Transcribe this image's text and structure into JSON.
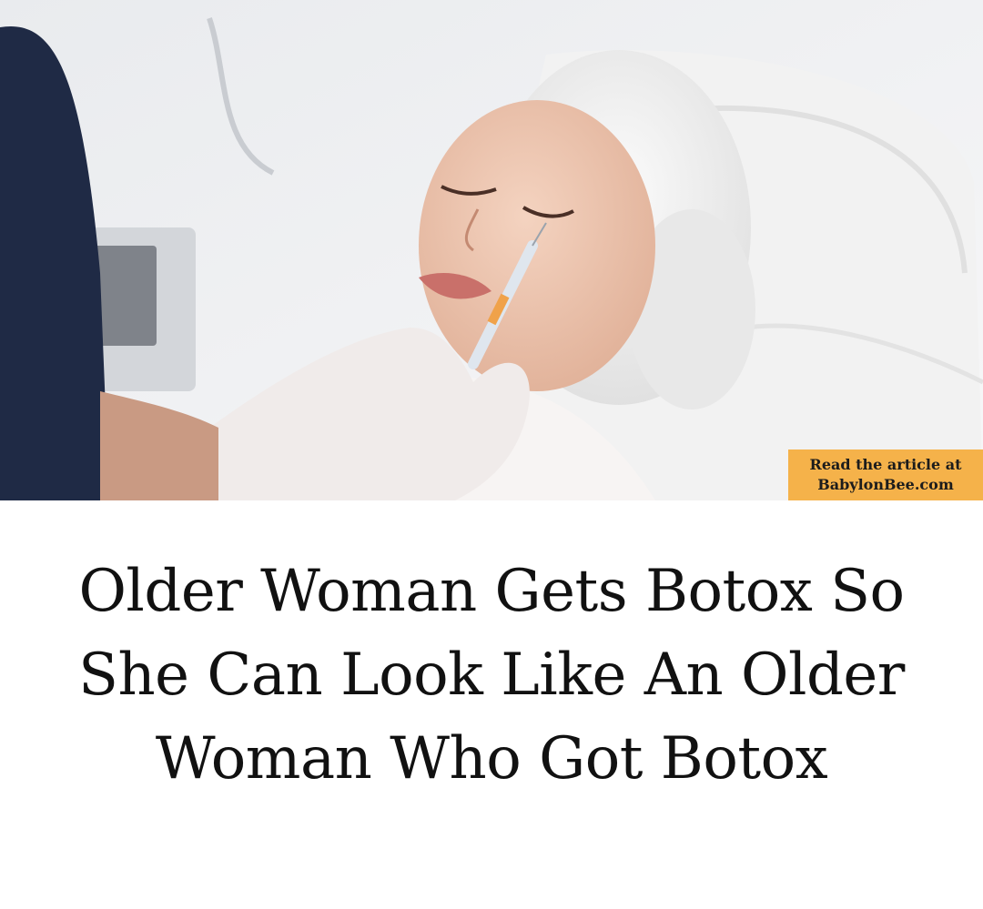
{
  "badge": {
    "line1": "Read the article at",
    "line2": "BabylonBee.com"
  },
  "headline": {
    "text": "Older Woman Gets Botox So She Can Look Like An Older Woman Who Got Botox"
  },
  "colors": {
    "badge_bg": "#f5b24a",
    "text": "#111111",
    "scrubs": "#1f2a45",
    "background": "#ffffff"
  }
}
